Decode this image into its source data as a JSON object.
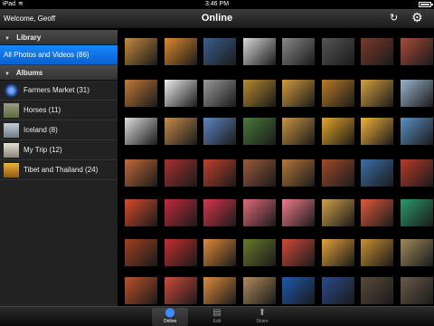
{
  "statusbar": {
    "carrier": "iPad",
    "wifi_icon": "wifi-icon",
    "time": "3:46 PM",
    "battery_icon": "battery-icon"
  },
  "navbar": {
    "welcome": "Welcome, Geoff",
    "title": "Online",
    "refresh_icon": "↻",
    "settings_icon": "⚙"
  },
  "sidebar": {
    "library_header": "Library",
    "library_items": [
      {
        "label": "All Photos and Videos (86)",
        "selected": true
      }
    ],
    "albums_header": "Albums",
    "albums": [
      {
        "label": "Farmers Market (31)"
      },
      {
        "label": "Horses (11)"
      },
      {
        "label": "Iceland (8)"
      },
      {
        "label": "My Trip (12)"
      },
      {
        "label": "Tibet and Thailand (24)"
      }
    ]
  },
  "tabs": [
    {
      "label": "Online",
      "icon": "⬤",
      "active": true
    },
    {
      "label": "Edit",
      "icon": "▤",
      "active": false
    },
    {
      "label": "Share",
      "icon": "⬆",
      "active": false
    }
  ],
  "colors": {
    "selected_row": "#0a6ff0",
    "background": "#000000"
  }
}
